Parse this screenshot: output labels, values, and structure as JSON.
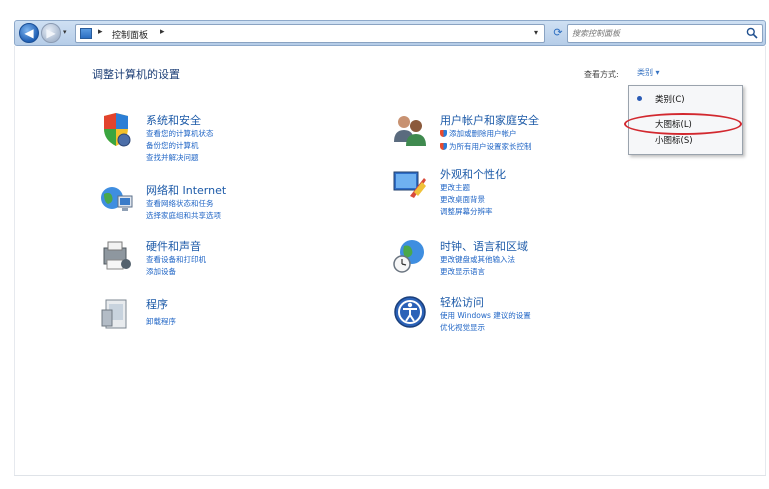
{
  "navbar": {
    "breadcrumb": "控制面板",
    "search_placeholder": "搜索控制面板"
  },
  "page_title": "调整计算机的设置",
  "view_by": {
    "label": "查看方式:",
    "selected": "类别 ▾",
    "options": [
      "类别(C)",
      "大图标(L)",
      "小图标(S)"
    ]
  },
  "categories": [
    {
      "title": "系统和安全",
      "links": [
        "查看您的计算机状态",
        "备份您的计算机",
        "查找并解决问题"
      ]
    },
    {
      "title": "网络和 Internet",
      "links": [
        "查看网络状态和任务",
        "选择家庭组和共享选项"
      ]
    },
    {
      "title": "硬件和声音",
      "links": [
        "查看设备和打印机",
        "添加设备"
      ]
    },
    {
      "title": "程序",
      "links": [
        "卸载程序"
      ]
    },
    {
      "title": "用户帐户和家庭安全",
      "links": [
        "添加或删除用户帐户",
        "为所有用户设置家长控制"
      ]
    },
    {
      "title": "外观和个性化",
      "links": [
        "更改主题",
        "更改桌面背景",
        "调整屏幕分辨率"
      ]
    },
    {
      "title": "时钟、语言和区域",
      "links": [
        "更改键盘或其他输入法",
        "更改显示语言"
      ]
    },
    {
      "title": "轻松访问",
      "links": [
        "使用 Windows 建议的设置",
        "优化视觉显示"
      ]
    }
  ],
  "colors": {
    "link": "#2166c6",
    "title": "#1c5aa8",
    "highlight": "#d2282f"
  }
}
